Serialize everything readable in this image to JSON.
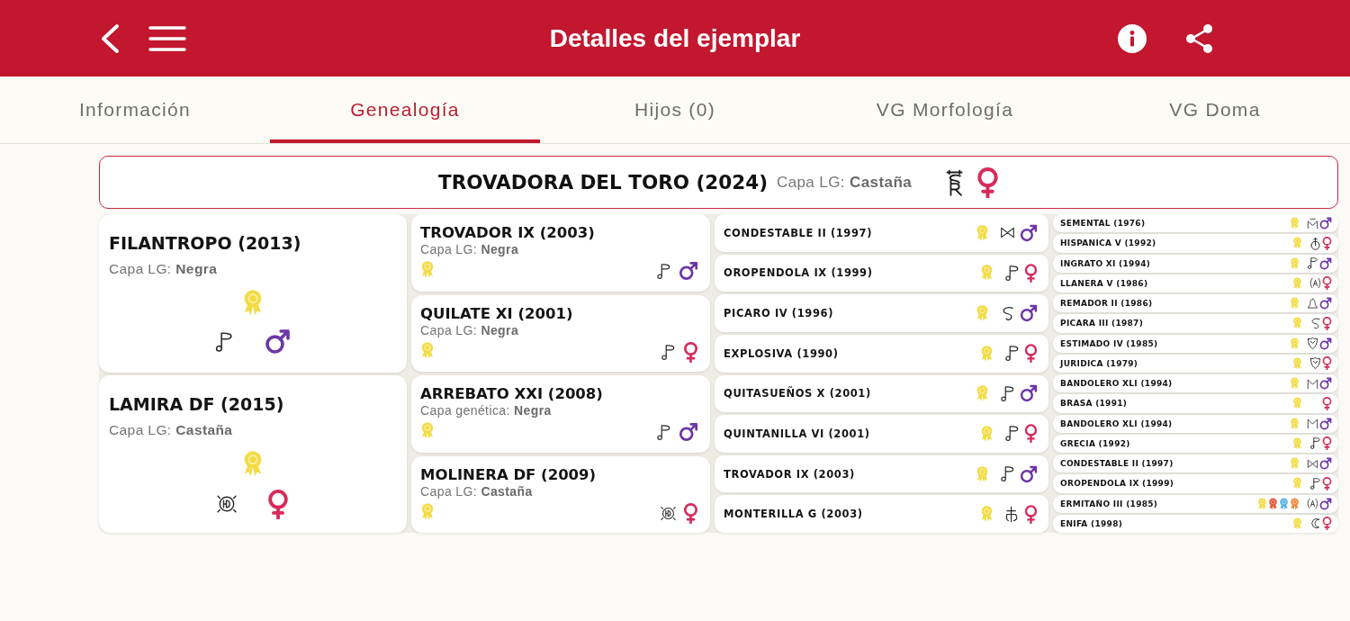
{
  "header": {
    "title": "Detalles del ejemplar"
  },
  "tabs": [
    {
      "label": "Información",
      "selected": false
    },
    {
      "label": "Genealogía",
      "selected": true
    },
    {
      "label": "Hijos (0)",
      "selected": false
    },
    {
      "label": "VG Morfología",
      "selected": false
    },
    {
      "label": "VG Doma",
      "selected": false
    }
  ],
  "horse": {
    "name": "TROVADORA DEL TORO (2024)",
    "coat": "Capa LG: **Castaña**",
    "brand": {
      "kind": "sr"
    },
    "sex": {
      "kind": "female"
    }
  },
  "pedigree": [
    {
      "horses": [
        {
          "name": "FILANTROPO (2013)",
          "coat": "Capa LG: **Negra**",
          "awards": [
            {
              "color": "#f3dc45"
            }
          ],
          "brand": {
            "kind": "note"
          },
          "sex": {
            "kind": "male"
          }
        },
        {
          "name": "LAMIRA DF (2015)",
          "coat": "Capa LG: **Castaña**",
          "awards": [
            {
              "color": "#f3dc45"
            }
          ],
          "brand": {
            "kind": "hd"
          },
          "sex": {
            "kind": "female"
          }
        }
      ]
    },
    {
      "horses": [
        {
          "name": "TROVADOR IX (2003)",
          "coat": "Capa LG: **Negra**",
          "awards": [
            {
              "color": "#f3dc45"
            }
          ],
          "brand": {
            "kind": "note"
          },
          "sex": {
            "kind": "male"
          }
        },
        {
          "name": "QUILATE XI (2001)",
          "coat": "Capa LG: **Negra**",
          "awards": [
            {
              "color": "#f3dc45"
            }
          ],
          "brand": {
            "kind": "note"
          },
          "sex": {
            "kind": "female"
          }
        },
        {
          "name": "ARREBATO XXI (2008)",
          "coat": "Capa genética: **Negra**",
          "awards": [
            {
              "color": "#f3dc45"
            }
          ],
          "brand": {
            "kind": "note"
          },
          "sex": {
            "kind": "male"
          }
        },
        {
          "name": "MOLINERA DF (2009)",
          "coat": "Capa LG: **Castaña**",
          "awards": [
            {
              "color": "#f3dc45"
            }
          ],
          "brand": {
            "kind": "hd"
          },
          "sex": {
            "kind": "female"
          }
        }
      ]
    },
    {
      "horses": [
        {
          "name": "CONDESTABLE II (1997)",
          "awards": [
            {
              "color": "#f3dc45"
            }
          ],
          "brand": {
            "kind": "bowtie"
          },
          "sex": {
            "kind": "male"
          }
        },
        {
          "name": "OROPENDOLA IX (1999)",
          "awards": [
            {
              "color": "#f3dc45"
            }
          ],
          "brand": {
            "kind": "note"
          },
          "sex": {
            "kind": "female"
          }
        },
        {
          "name": "PICARO IV (1996)",
          "awards": [
            {
              "color": "#f3dc45"
            }
          ],
          "brand": {
            "kind": "hook"
          },
          "sex": {
            "kind": "male"
          }
        },
        {
          "name": "EXPLOSIVA (1990)",
          "awards": [
            {
              "color": "#f3dc45"
            }
          ],
          "brand": {
            "kind": "note"
          },
          "sex": {
            "kind": "female"
          }
        },
        {
          "name": "QUITASUEÑOS X (2001)",
          "awards": [
            {
              "color": "#f3dc45"
            }
          ],
          "brand": {
            "kind": "note"
          },
          "sex": {
            "kind": "male"
          }
        },
        {
          "name": "QUINTANILLA VI (2001)",
          "awards": [
            {
              "color": "#f3dc45"
            }
          ],
          "brand": {
            "kind": "note"
          },
          "sex": {
            "kind": "female"
          }
        },
        {
          "name": "TROVADOR IX (2003)",
          "awards": [
            {
              "color": "#f3dc45"
            }
          ],
          "brand": {
            "kind": "note"
          },
          "sex": {
            "kind": "male"
          }
        },
        {
          "name": "MONTERILLA G (2003)",
          "awards": [
            {
              "color": "#f3dc45"
            }
          ],
          "brand": {
            "kind": "cross"
          },
          "sex": {
            "kind": "female"
          }
        }
      ]
    },
    {
      "horses": [
        {
          "name": "SEMENTAL (1976)",
          "awards": [
            {
              "color": "#f3dc45"
            }
          ],
          "brand": {
            "kind": "mbar"
          },
          "sex": {
            "kind": "male"
          }
        },
        {
          "name": "HISPANICA V (1992)",
          "awards": [
            {
              "color": "#f3dc45"
            }
          ],
          "brand": {
            "kind": "ringarrow"
          },
          "sex": {
            "kind": "female"
          }
        },
        {
          "name": "INGRATO XI (1994)",
          "awards": [
            {
              "color": "#f3dc45"
            }
          ],
          "brand": {
            "kind": "note"
          },
          "sex": {
            "kind": "male"
          }
        },
        {
          "name": "LLANERA V (1986)",
          "awards": [
            {
              "color": "#f3dc45"
            }
          ],
          "brand": {
            "kind": "bracketa"
          },
          "sex": {
            "kind": "female"
          }
        },
        {
          "name": "REMADOR II (1986)",
          "awards": [
            {
              "color": "#f3dc45"
            }
          ],
          "brand": {
            "kind": "bell"
          },
          "sex": {
            "kind": "male"
          }
        },
        {
          "name": "PICARA III (1987)",
          "awards": [
            {
              "color": "#f3dc45"
            }
          ],
          "brand": {
            "kind": "hook"
          },
          "sex": {
            "kind": "female"
          }
        },
        {
          "name": "ESTIMADO IV (1985)",
          "awards": [
            {
              "color": "#f3dc45"
            }
          ],
          "brand": {
            "kind": "shield"
          },
          "sex": {
            "kind": "male"
          }
        },
        {
          "name": "JURIDICA (1979)",
          "awards": [
            {
              "color": "#f3dc45"
            }
          ],
          "brand": {
            "kind": "shield"
          },
          "sex": {
            "kind": "female"
          }
        },
        {
          "name": "BANDOLERO XLI (1994)",
          "awards": [
            {
              "color": "#f3dc45"
            }
          ],
          "brand": {
            "kind": "m"
          },
          "sex": {
            "kind": "male"
          }
        },
        {
          "name": "BRASA (1991)",
          "awards": [
            {
              "color": "#f3dc45"
            }
          ],
          "sex": {
            "kind": "female"
          }
        },
        {
          "name": "BANDOLERO XLI (1994)",
          "awards": [
            {
              "color": "#f3dc45"
            }
          ],
          "brand": {
            "kind": "m"
          },
          "sex": {
            "kind": "male"
          }
        },
        {
          "name": "GRECIA (1992)",
          "awards": [
            {
              "color": "#f3dc45"
            }
          ],
          "brand": {
            "kind": "note"
          },
          "sex": {
            "kind": "female"
          }
        },
        {
          "name": "CONDESTABLE II (1997)",
          "awards": [
            {
              "color": "#f3dc45"
            }
          ],
          "brand": {
            "kind": "bowtie"
          },
          "sex": {
            "kind": "male"
          }
        },
        {
          "name": "OROPENDOLA IX (1999)",
          "awards": [
            {
              "color": "#f3dc45"
            }
          ],
          "brand": {
            "kind": "note"
          },
          "sex": {
            "kind": "female"
          }
        },
        {
          "name": "ERMITAÑO III (1985)",
          "awards": [
            {
              "color": "#f3dc45"
            },
            {
              "color": "#e2593f"
            },
            {
              "color": "#56b4e8"
            },
            {
              "color": "#f08b3c"
            }
          ],
          "brand": {
            "kind": "bracketa"
          },
          "sex": {
            "kind": "male"
          }
        },
        {
          "name": "ENIFA (1998)",
          "awards": [
            {
              "color": "#f3dc45"
            }
          ],
          "brand": {
            "kind": "crescent"
          },
          "sex": {
            "kind": "female"
          }
        }
      ]
    }
  ]
}
